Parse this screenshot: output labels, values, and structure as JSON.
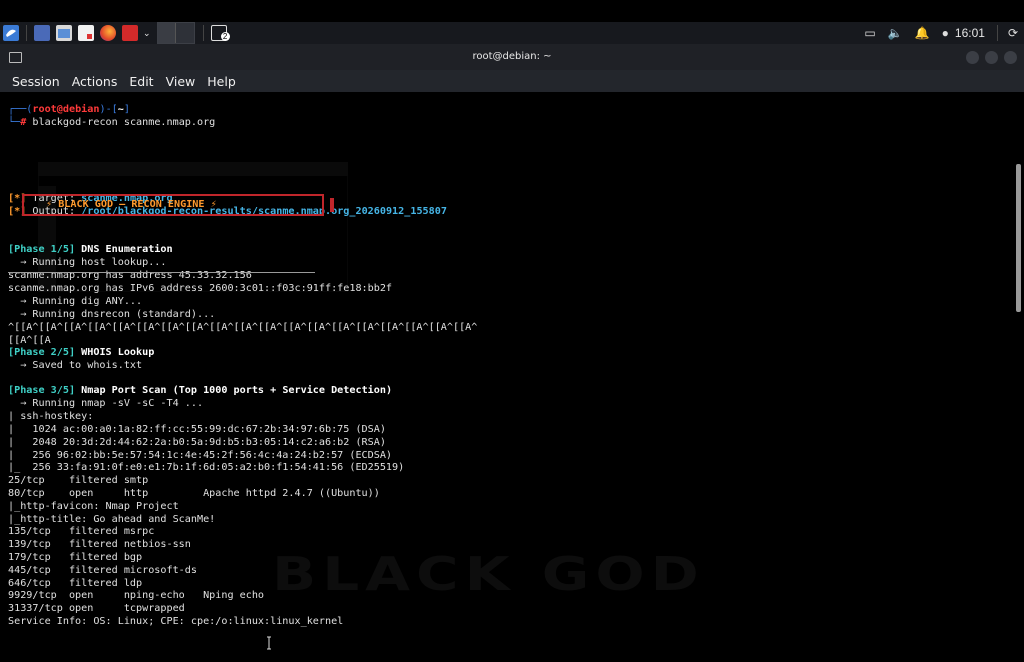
{
  "taskbar": {
    "clock": "16:01",
    "terminal_badge": "2"
  },
  "window": {
    "title": "root@debian: ~"
  },
  "menu": [
    "Session",
    "Actions",
    "Edit",
    "View",
    "Help"
  ],
  "prompt": {
    "user": "root",
    "at": "@",
    "host": "debian",
    "dir": "~",
    "command": "blackgod-recon scanme.nmap.org"
  },
  "banner": "⚡ BLACK GOD — RECON ENGINE ⚡",
  "info": {
    "target_label": " Target: ",
    "target_value": "scanme.nmap.org",
    "output_label": " Output: ",
    "output_value": "/root/blackgod-recon-results/scanme.nmap.org_20260912_155807"
  },
  "phase1": {
    "tag": "[Phase 1/5]",
    "title": " DNS Enumeration",
    "lines": [
      "  → Running host lookup...",
      "scanme.nmap.org has address 45.33.32.156",
      "scanme.nmap.org has IPv6 address 2600:3c01::f03c:91ff:fe18:bb2f",
      "  → Running dig ANY...",
      "  → Running dnsrecon (standard)...",
      "^[[A^[[A^[[A^[[A^[[A^[[A^[[A^[[A^[[A^[[A^[[A^[[A^[[A^[[A^[[A^[[A^[[A^[[A^[[A^",
      "[[A^[[A"
    ]
  },
  "phase2": {
    "tag": "[Phase 2/5]",
    "title": " WHOIS Lookup",
    "lines": [
      "  → Saved to whois.txt"
    ]
  },
  "phase3": {
    "tag": "[Phase 3/5]",
    "title": " Nmap Port Scan (Top 1000 ports + Service Detection)",
    "lines": [
      "  → Running nmap -sV -sC -T4 ...",
      "| ssh-hostkey:",
      "|   1024 ac:00:a0:1a:82:ff:cc:55:99:dc:67:2b:34:97:6b:75 (DSA)",
      "|   2048 20:3d:2d:44:62:2a:b0:5a:9d:b5:b3:05:14:c2:a6:b2 (RSA)",
      "|   256 96:02:bb:5e:57:54:1c:4e:45:2f:56:4c:4a:24:b2:57 (ECDSA)",
      "|_  256 33:fa:91:0f:e0:e1:7b:1f:6d:05:a2:b0:f1:54:41:56 (ED25519)",
      "25/tcp    filtered smtp",
      "80/tcp    open     http         Apache httpd 2.4.7 ((Ubuntu))",
      "|_http-favicon: Nmap Project",
      "|_http-title: Go ahead and ScanMe!",
      "135/tcp   filtered msrpc",
      "139/tcp   filtered netbios-ssn",
      "179/tcp   filtered bgp",
      "445/tcp   filtered microsoft-ds",
      "646/tcp   filtered ldp",
      "9929/tcp  open     nping-echo   Nping echo",
      "31337/tcp open     tcpwrapped",
      "Service Info: OS: Linux; CPE: cpe:/o:linux:linux_kernel"
    ]
  },
  "watermark": "BLACK GOD",
  "colors": {
    "accent_orange": "#ff9a2e",
    "phase_teal": "#3fd0c6",
    "banner_red": "#c0262b",
    "link_blue": "#3d7cff"
  }
}
